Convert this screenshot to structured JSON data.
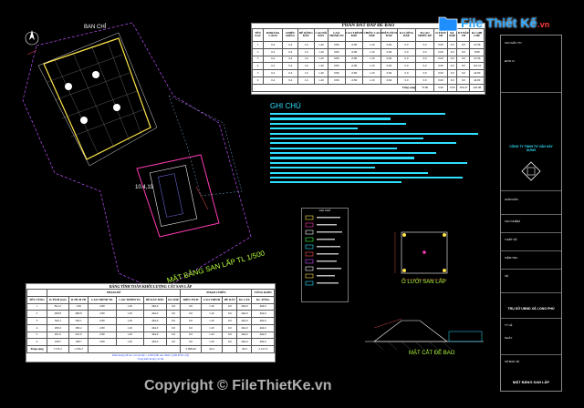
{
  "watermark": {
    "brand": "File Thiết Kế",
    "domain": ".vn",
    "copyright": "Copyright © FileThietKe.vn"
  },
  "site_plan": {
    "north_label": "BAN CHỈ",
    "plan_label": "MẶT BẰNG SAN LẤP TL 1/500",
    "inner_label": "10.4,19"
  },
  "top_table": {
    "title": "PHẦN ĐẤT ĐẮP ĐÊ BAO",
    "headers": [
      "TÊN CỌC",
      "KHOẢNG CÁCH",
      "CHIỀU RỘNG",
      "BỀ RỘNG ĐÁY",
      "CAO ĐỘ ĐÁY",
      "CAO TRÌNH TN",
      "CAO TRÌNH ĐẮP",
      "CHIỀU CAO ĐẮP",
      "DIỆN TÍCH ĐẮP",
      "K.LƯỢNG ĐẮP",
      "Đ.CAO THIẾT KẾ",
      "D.TÍCH TB",
      "KL ĐẮP",
      "DT ĐẮP TB",
      "KL GHI CHÚ"
    ],
    "rows": [
      [
        "1",
        "0.4",
        "0.4",
        "1.6",
        "1.40",
        "0.86",
        "-0.80",
        "1.20",
        "0.84",
        "0.0",
        "0.0",
        "0.00",
        "0.0",
        "0.0",
        "47.66"
      ],
      [
        "2",
        "0.4",
        "0.4",
        "1.6",
        "1.40",
        "0.86",
        "-0.80",
        "1.20",
        "0.84",
        "0.0",
        "0.0",
        "0.00",
        "0.0",
        "0.0",
        "8.88"
      ],
      [
        "3",
        "0.4",
        "0.4",
        "1.6",
        "1.40",
        "0.86",
        "-0.80",
        "1.20",
        "0.84",
        "0.0",
        "0.0",
        "0.00",
        "0.0",
        "0.0",
        "47.66"
      ],
      [
        "4",
        "0.4",
        "0.4",
        "1.6",
        "1.40",
        "0.86",
        "-0.80",
        "1.20",
        "0.84",
        "0.0",
        "0.0",
        "0.00",
        "0.0",
        "0.0",
        "122.16"
      ],
      [
        "5",
        "0.4",
        "0.4",
        "1.6",
        "1.40",
        "0.86",
        "-0.80",
        "1.20",
        "0.84",
        "0.0",
        "0.0",
        "0.00",
        "0.0",
        "0.0",
        "44.80"
      ],
      [
        "6",
        "0.4",
        "0.4",
        "1.6",
        "1.40",
        "0.86",
        "-0.80",
        "1.20",
        "0.84",
        "0.0",
        "0.0",
        "0.00",
        "0.0",
        "0.0",
        "44.80"
      ]
    ],
    "total_label": "Tổng cộng",
    "total_values": [
      "70.80",
      "0.00",
      "0.00",
      "200.47",
      "226.08"
    ]
  },
  "notes": {
    "heading": "GHI CHÚ"
  },
  "legend": {
    "title": "GHI CHÚ"
  },
  "detail_labels": {
    "grid": "Ô LƯỚI SAN LẤP",
    "section": "MẶT CẮT ĐÊ BAO"
  },
  "bottom_table": {
    "title": "BẢNG TÍNH TOÁN KHỐI LƯỢNG CÁT SAN LẤP",
    "group_headers": [
      "PHẠM ĐỔ",
      "PHẠM CHIÊN",
      "TỔNG KHỐI"
    ],
    "headers": [
      "TÊN VÙNG",
      "D.TÍCH (m2)",
      "D.TÍCH TB",
      "CAO TRÌNH TK",
      "CAO TRÌNH TN",
      "BỀ DÀY ĐẮP",
      "KL ĐẮP",
      "DIỆN TÍCH",
      "CAO TRÌNH",
      "BỀ DÀY",
      "KL CÁT",
      "KL TỔNG"
    ],
    "rows": [
      [
        "1",
        "84.12",
        "1.09",
        "2.80",
        "1.20",
        "464.0",
        "0.0",
        "0.0",
        "1.20",
        "0.0",
        "464.0",
        "464.0"
      ],
      [
        "2",
        "480.8",
        "480.8",
        "2.80",
        "1.20",
        "464.0",
        "0.0",
        "0.0",
        "1.20",
        "0.0",
        "464.0",
        "464.0"
      ],
      [
        "3",
        "560.1",
        "560.1",
        "2.80",
        "1.20",
        "464.0",
        "0.0",
        "0.0",
        "1.20",
        "0.0",
        "464.0",
        "464.0"
      ],
      [
        "4",
        "280.2",
        "280.2",
        "2.80",
        "1.20",
        "464.0",
        "0.0",
        "0.0",
        "1.20",
        "0.0",
        "464.0",
        "464.0"
      ],
      [
        "5",
        "201.0",
        "201.0",
        "2.80",
        "1.20",
        "464.0",
        "0.0",
        "0.0",
        "1.20",
        "0.0",
        "464.0",
        "464.0"
      ],
      [
        "6",
        "168.7",
        "168.7",
        "2.80",
        "1.20",
        "464.0",
        "0.0",
        "0.0",
        "1.20",
        "0.0",
        "464.0",
        "464.0"
      ]
    ],
    "total_label": "Tổng cộng",
    "total_values": [
      "1733.2",
      "1,706.3",
      "2,098.40",
      "26.4",
      "29.0",
      "2,127.4"
    ],
    "footnote1": "Khối lượng đề bao cát san lấp = 2,000 (đất san chiến 1) (60,870/1.2,0)",
    "footnote2": "Tổng khối lượng cát lấp"
  },
  "title_block": {
    "company": "CÔNG TY TNHH TƯ VẤN XÂY DỰNG",
    "project": "TRỤ SỞ UBND XÃ LONG PHÚ",
    "sheet_title": "MẶT BẰNG SAN LẤP",
    "rows": [
      "CHỦ ĐẦU TƯ",
      "ĐƠN VỊ",
      "GIÁM ĐỐC",
      "CHỦ NHIỆM",
      "THIẾT KẾ",
      "KIỂM TRA",
      "VẼ",
      "TỶ LỆ",
      "NGÀY",
      "SỐ BẢN VẼ"
    ]
  }
}
